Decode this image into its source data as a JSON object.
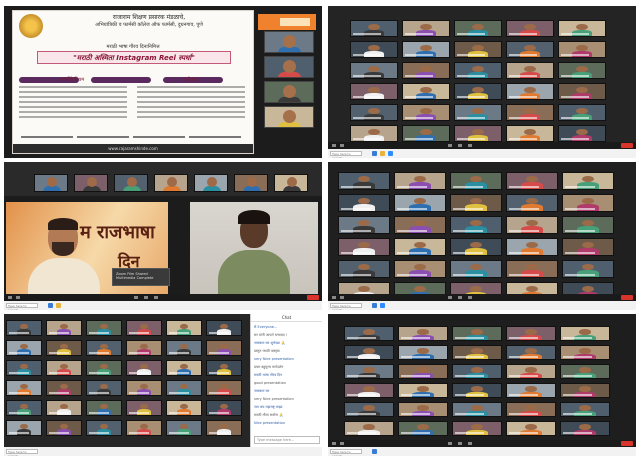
{
  "poster": {
    "org": "राजाराम शिक्षण प्रसारक मंडळाचे,",
    "dept": "अभियांत्रिकी व फार्मसी कॉलेज ऑफ फार्मसी, दुधनगाव, पुणे",
    "sub": "मराठी भाषा गौरव दिनानिमित्त",
    "title": "\"मराठी अस्मिता Instagram Reel स्पर्धा\"",
    "col_left_heading": "स्पर्धेचे नियम",
    "col_right_heading": "परीक्षण",
    "footer": "www.rajaramshinde.com"
  },
  "speaker_view": {
    "banner_line1": "म राजभाषा",
    "banner_line2": "दिन",
    "popup_text": "Zoom Film Shared Multimedia Complete"
  },
  "chat": {
    "header": "Chat",
    "messages": [
      "से Everyone...",
      "सर यांनी आपले धन्यवाद !",
      "नमस्कार सर शुभेच्छा 🙏",
      "प्रस्तुत मराठी वक्तृत्व",
      "very Nice presentation",
      "प्रथम बहुमुल्य मार्गदर्शन",
      "मराठी भाषा गौरव दिन",
      "good presentation",
      "नमस्कार सर",
      "very Nice presentation",
      "जय जय महाराष्ट्र माझा",
      "मराठी गौरव सर्वांना 🙏",
      "Nice presentation"
    ],
    "input_placeholder": "Type message here..."
  },
  "taskbar": {
    "search_label": "Type here to search"
  },
  "colors": {
    "poster_title_text": "#8a1436",
    "banner_orange": "#f0822d",
    "zoom_leave_red": "#d9342b",
    "chat_link_blue": "#2f5da8"
  },
  "icons": [
    "windows-search-icon",
    "zoom-toolbar-icons",
    "leave-button"
  ]
}
